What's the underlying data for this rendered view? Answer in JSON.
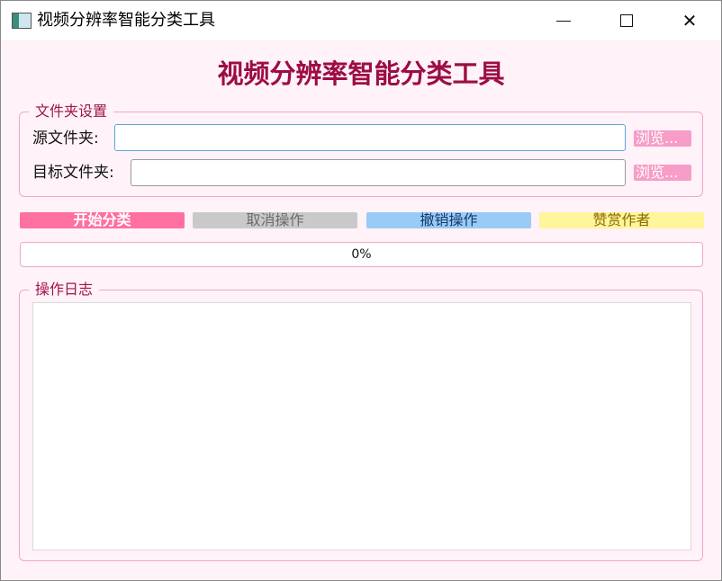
{
  "window": {
    "title": "视频分辨率智能分类工具",
    "app_icon": "app-icon",
    "controls": {
      "minimize_icon": "minimize-icon",
      "maximize_icon": "maximize-icon",
      "close_icon": "close-icon",
      "close_glyph": "✕"
    }
  },
  "heading": "视频分辨率智能分类工具",
  "folder_settings": {
    "legend": "文件夹设置",
    "source_label": "源文件夹:",
    "source_value": "",
    "target_label": "目标文件夹:",
    "target_value": "",
    "browse_label": "浏览..."
  },
  "actions": {
    "start": "开始分类",
    "cancel": "取消操作",
    "undo": "撤销操作",
    "donate": "赞赏作者"
  },
  "progress": {
    "value": 0,
    "text": "0%"
  },
  "log": {
    "legend": "操作日志",
    "content": ""
  },
  "colors": {
    "accent": "#ff6fa0",
    "heading": "#9c0d45",
    "background": "#fff2f8",
    "cancel": "#c9c9c9",
    "undo": "#99cbf7",
    "donate": "#fff59a"
  }
}
